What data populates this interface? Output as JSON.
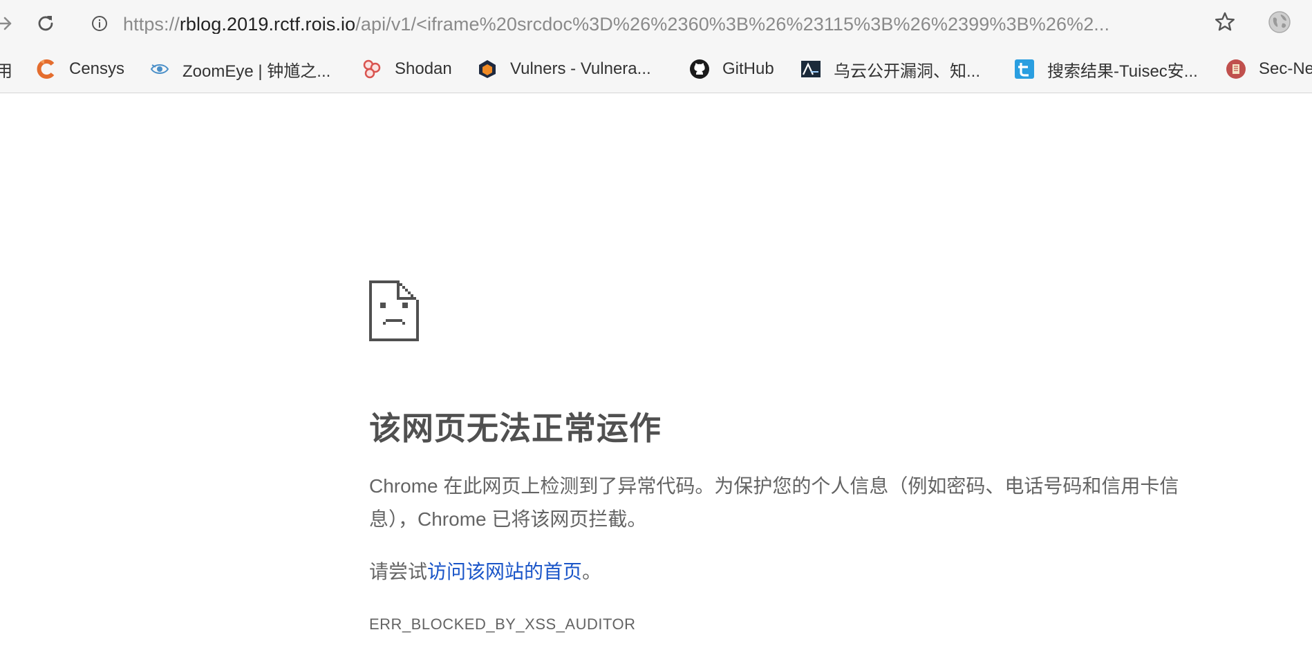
{
  "toolbar": {
    "back_icon": "arrow-right-icon",
    "reload_icon": "reload-icon",
    "url": {
      "scheme": "https://",
      "host": "rblog.2019.rctf.rois.io",
      "path": "/api/v1/<iframe%20srcdoc%3D%26%2360%3B%26%23115%3B%26%2399%3B%26%2..."
    },
    "star_icon": "star-icon",
    "profile_icon": "globe-icon"
  },
  "bookmarks": [
    {
      "label": "用",
      "icon": "apps-icon"
    },
    {
      "label": "Censys",
      "icon": "censys-icon"
    },
    {
      "label": "ZoomEye | 钟馗之...",
      "icon": "zoomeye-icon"
    },
    {
      "label": "Shodan",
      "icon": "shodan-icon"
    },
    {
      "label": "Vulners - Vulnera...",
      "icon": "vulners-icon"
    },
    {
      "label": "GitHub",
      "icon": "github-icon"
    },
    {
      "label": "乌云公开漏洞、知...",
      "icon": "wooyun-icon"
    },
    {
      "label": "搜索结果-Tuisec安...",
      "icon": "tuisec-icon"
    },
    {
      "label": "Sec-Ne",
      "icon": "secnews-icon"
    }
  ],
  "error": {
    "icon": "sad-page-icon",
    "title": "该网页无法正常运作",
    "description": "Chrome 在此网页上检测到了异常代码。为保护您的个人信息（例如密码、电话号码和信用卡信息），Chrome 已将该网页拦截。",
    "suggest_prefix": "请尝试",
    "suggest_link": "访问该网站的首页",
    "suggest_suffix": "。",
    "code": "ERR_BLOCKED_BY_XSS_AUDITOR"
  },
  "colors": {
    "toolbar_bg": "#f6f6f6",
    "link": "#1a55c8",
    "title": "#505050",
    "body_text": "#646464"
  }
}
